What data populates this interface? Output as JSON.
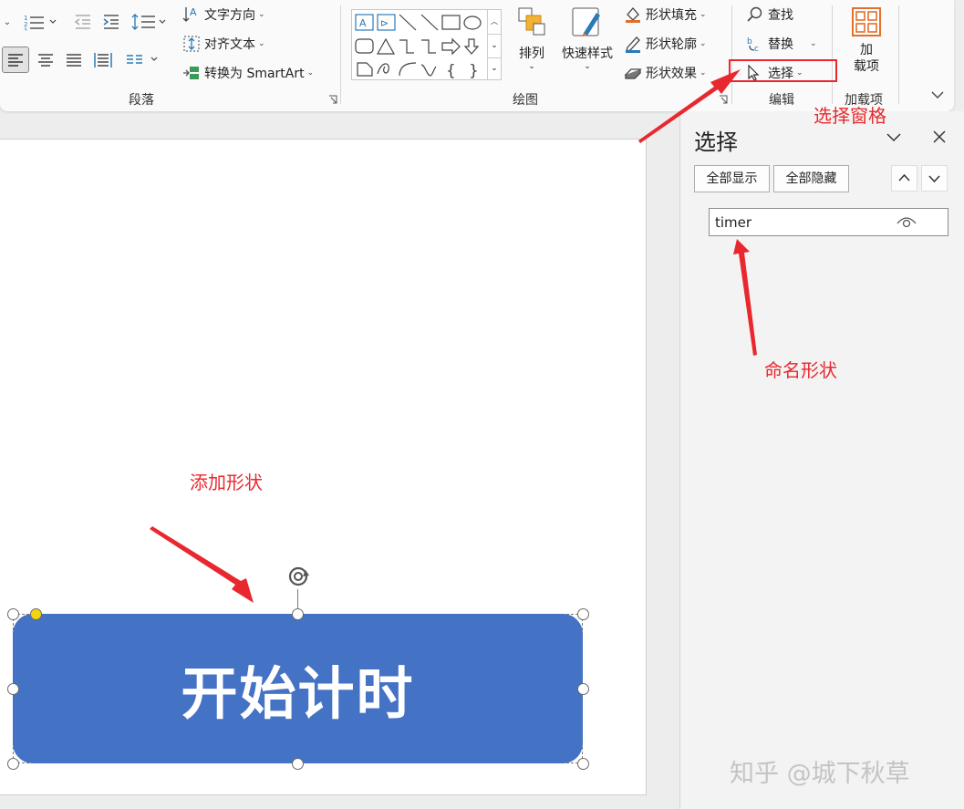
{
  "ribbon": {
    "paragraph": {
      "group_label": "段落",
      "text_direction": "文字方向",
      "align_text": "对齐文本",
      "convert_smartart": "转换为 SmartArt"
    },
    "drawing": {
      "group_label": "绘图",
      "arrange": "排列",
      "quick_styles": "快速样式",
      "shape_fill": "形状填充",
      "shape_outline": "形状轮廓",
      "shape_effects": "形状效果"
    },
    "editing": {
      "group_label": "编辑",
      "find": "查找",
      "replace": "替换",
      "select": "选择"
    },
    "addins": {
      "group_label": "加载项",
      "button_line1": "加",
      "button_line2": "载项"
    }
  },
  "pane": {
    "title": "选择",
    "show_all": "全部显示",
    "hide_all": "全部隐藏",
    "items": [
      {
        "name": "timer"
      }
    ]
  },
  "slide": {
    "shape_text": "开始计时"
  },
  "annotations": {
    "select_pane": "选择窗格",
    "name_shape": "命名形状",
    "add_shape": "添加形状"
  },
  "watermark": "知乎 @城下秋草",
  "colors": {
    "shape_fill": "#4472c4",
    "annotation": "#e8282e",
    "accent_orange": "#e0702a",
    "accent_blue": "#2a7ab8"
  }
}
